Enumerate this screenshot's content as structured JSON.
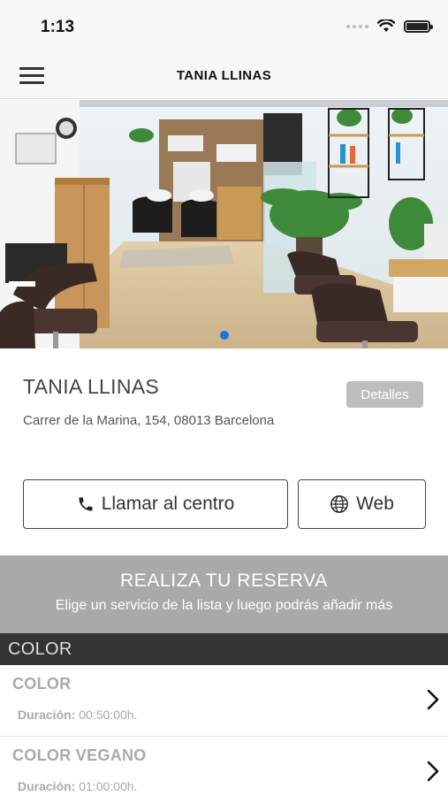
{
  "status_bar": {
    "time": "1:13"
  },
  "nav": {
    "title": "TANIA LLINAS",
    "menu_icon": "hamburger-menu-icon"
  },
  "hero": {
    "image": "salon interior photo carousel",
    "pages": 1,
    "current_page": 1
  },
  "salon": {
    "name": "TANIA LLINAS",
    "address": "Carrer de la Marina, 154, 08013 Barcelona",
    "details_label": "Detalles"
  },
  "actions": {
    "call_label": "Llamar al centro",
    "call_icon": "phone-icon",
    "web_label": "Web",
    "web_icon": "globe-icon"
  },
  "booking": {
    "title": "REALIZA TU RESERVA",
    "subtitle": "Elige un servicio de la lista y luego podrás añadir más"
  },
  "category": {
    "name": "COLOR"
  },
  "services": [
    {
      "name": "COLOR",
      "duration_label": "Duración:",
      "duration": "00:50:00h."
    },
    {
      "name": "COLOR VEGANO",
      "duration_label": "Duración:",
      "duration": "01:00:00h."
    }
  ],
  "colors": {
    "accent_dot": "#1a73e8",
    "banner_bg": "#a9a9a9",
    "category_bg": "#333333",
    "details_bg": "#bdbdbd"
  }
}
